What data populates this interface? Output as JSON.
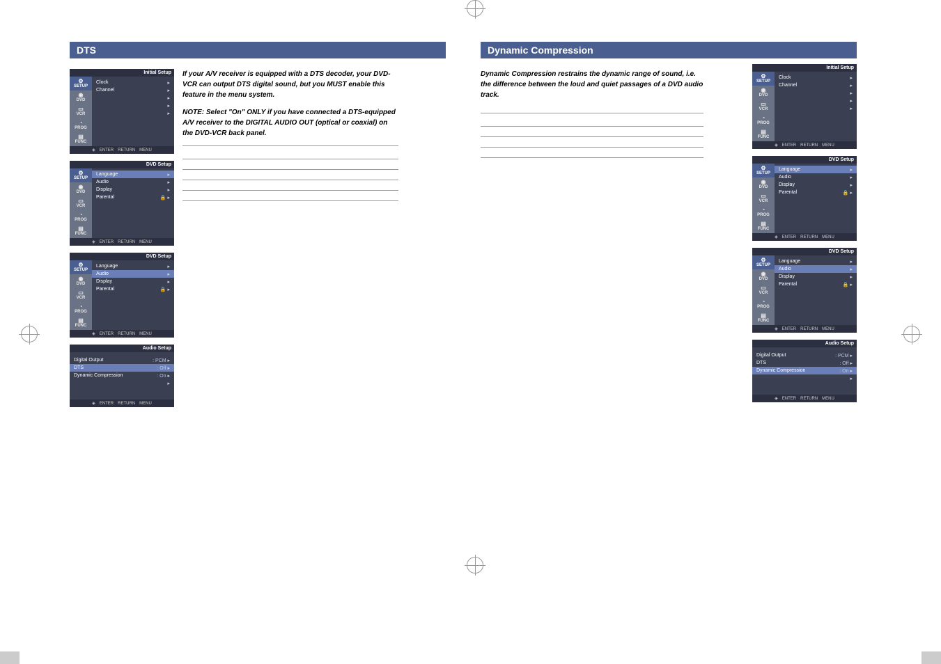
{
  "left": {
    "heading": "DTS",
    "para1": "If your A/V receiver is equipped with a DTS decoder, your DVD-VCR can output DTS digital sound, but you MUST enable this feature in the menu system.",
    "para2": "NOTE: Select \"On\" ONLY if you have connected a DTS-equipped A/V receiver to the DIGITAL AUDIO OUT (optical or coaxial) on the DVD-VCR back panel."
  },
  "right": {
    "heading": "Dynamic Compression",
    "para1": "Dynamic Compression restrains the dynamic range of sound, i.e. the difference between the loud and quiet passages of a DVD audio track."
  },
  "sidebar": {
    "setup": "SETUP",
    "dvd": "DVD",
    "vcr": "VCR",
    "prog": "PROG",
    "func": "FUNC"
  },
  "initial": {
    "title": "Initial Setup",
    "clock": "Clock",
    "channel": "Channel"
  },
  "dvdsetup": {
    "title": "DVD Setup",
    "language": "Language",
    "audio": "Audio",
    "display": "Display",
    "parental": "Parental"
  },
  "audiosetup": {
    "title": "Audio Setup",
    "digital_output": "Digital Output",
    "digital_output_val": ": PCM",
    "dts": "DTS",
    "dts_val": ": Off",
    "dyn": "Dynamic Compression",
    "dyn_val": ": On"
  },
  "footer": {
    "enter": "ENTER",
    "return": "RETURN",
    "menu": "MENU"
  }
}
